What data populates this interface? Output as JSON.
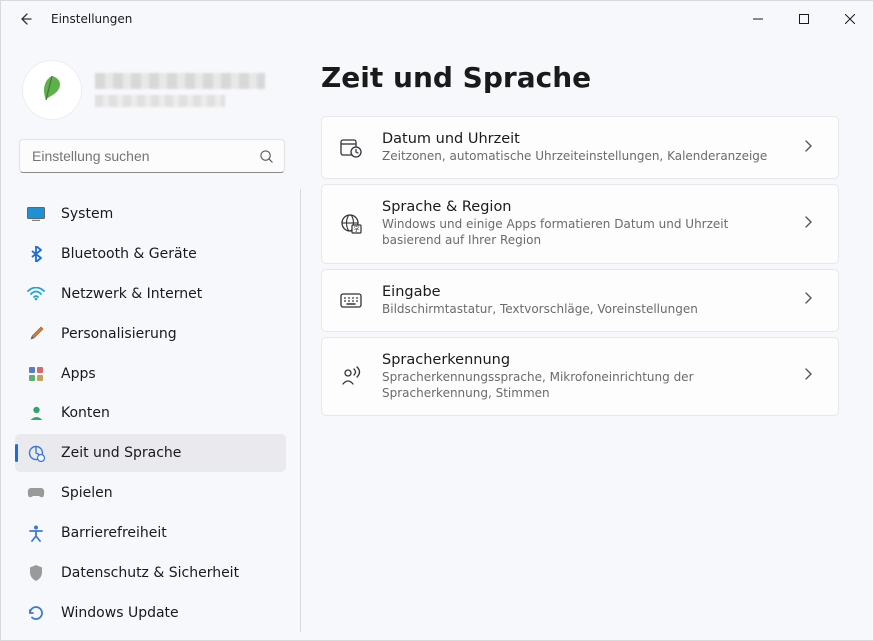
{
  "titlebar": {
    "title": "Einstellungen"
  },
  "search": {
    "placeholder": "Einstellung suchen"
  },
  "sidebar": {
    "items": [
      {
        "id": "system",
        "label": "System"
      },
      {
        "id": "bluetooth",
        "label": "Bluetooth & Geräte"
      },
      {
        "id": "network",
        "label": "Netzwerk & Internet"
      },
      {
        "id": "personalization",
        "label": "Personalisierung"
      },
      {
        "id": "apps",
        "label": "Apps"
      },
      {
        "id": "accounts",
        "label": "Konten"
      },
      {
        "id": "time-language",
        "label": "Zeit und Sprache"
      },
      {
        "id": "gaming",
        "label": "Spielen"
      },
      {
        "id": "accessibility",
        "label": "Barrierefreiheit"
      },
      {
        "id": "privacy",
        "label": "Datenschutz & Sicherheit"
      },
      {
        "id": "windows-update",
        "label": "Windows Update"
      }
    ],
    "active_id": "time-language"
  },
  "page": {
    "title": "Zeit und Sprache",
    "cards": [
      {
        "id": "date-time",
        "title": "Datum und Uhrzeit",
        "desc": "Zeitzonen, automatische Uhrzeiteinstellungen, Kalenderanzeige"
      },
      {
        "id": "language-region",
        "title": "Sprache & Region",
        "desc": "Windows und einige Apps formatieren Datum und Uhrzeit basierend auf Ihrer Region"
      },
      {
        "id": "typing",
        "title": "Eingabe",
        "desc": "Bildschirmtastatur, Textvorschläge, Voreinstellungen"
      },
      {
        "id": "speech",
        "title": "Spracherkennung",
        "desc": "Spracherkennungssprache, Mikrofoneinrichtung der Spracherkennung, Stimmen"
      }
    ]
  }
}
